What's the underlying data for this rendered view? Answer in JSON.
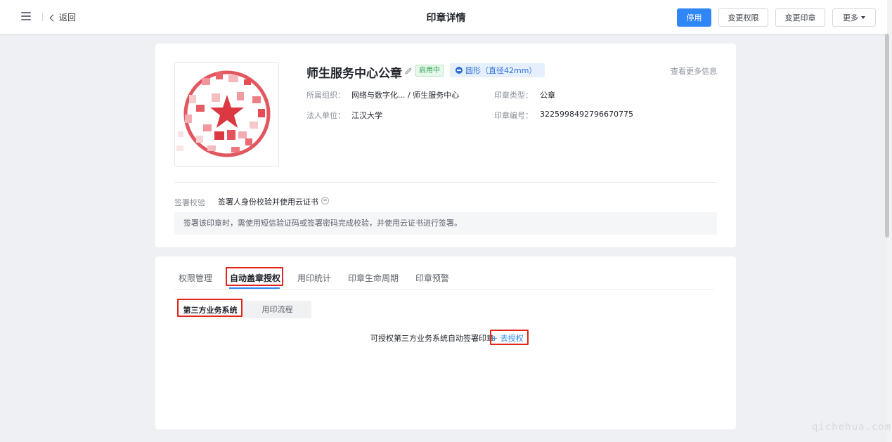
{
  "header": {
    "back_label": "返回",
    "title": "印章详情",
    "buttons": {
      "disable": "停用",
      "change_permission": "变更权限",
      "change_seal": "变更印章",
      "more": "更多"
    }
  },
  "seal": {
    "name": "师生服务中心公章",
    "status": "启用中",
    "shape": "圆形（直径42mm）",
    "more_info": "查看更多信息",
    "fields": {
      "org_label": "所属组织：",
      "org_value": "网络与数字化... / 师生服务中心",
      "type_label": "印章类型：",
      "type_value": "公章",
      "legal_label": "法人单位：",
      "legal_value": "江汉大学",
      "code_label": "印章编号：",
      "code_value": "3225998492796670775"
    },
    "verify_label": "签署校验",
    "verify_value": "签署人身份校验并使用云证书",
    "verify_note": "签署该印章时，需使用短信验证码或签署密码完成校验，并使用云证书进行签署。"
  },
  "tabs": [
    {
      "label": "权限管理"
    },
    {
      "label": "自动盖章授权"
    },
    {
      "label": "用印统计"
    },
    {
      "label": "印章生命周期"
    },
    {
      "label": "印章预警"
    }
  ],
  "sub_tabs": [
    {
      "label": "第三方业务系统"
    },
    {
      "label": "用印流程"
    }
  ],
  "empty_state": {
    "text": "可授权第三方业务系统自动签署印章",
    "link": "+ 去授权"
  },
  "watermark": "qichehua.com",
  "colors": {
    "primary": "#2f86f6",
    "seal_red": "#d9232e",
    "highlight_red": "#e1261c",
    "status_green": "#2ea352"
  }
}
